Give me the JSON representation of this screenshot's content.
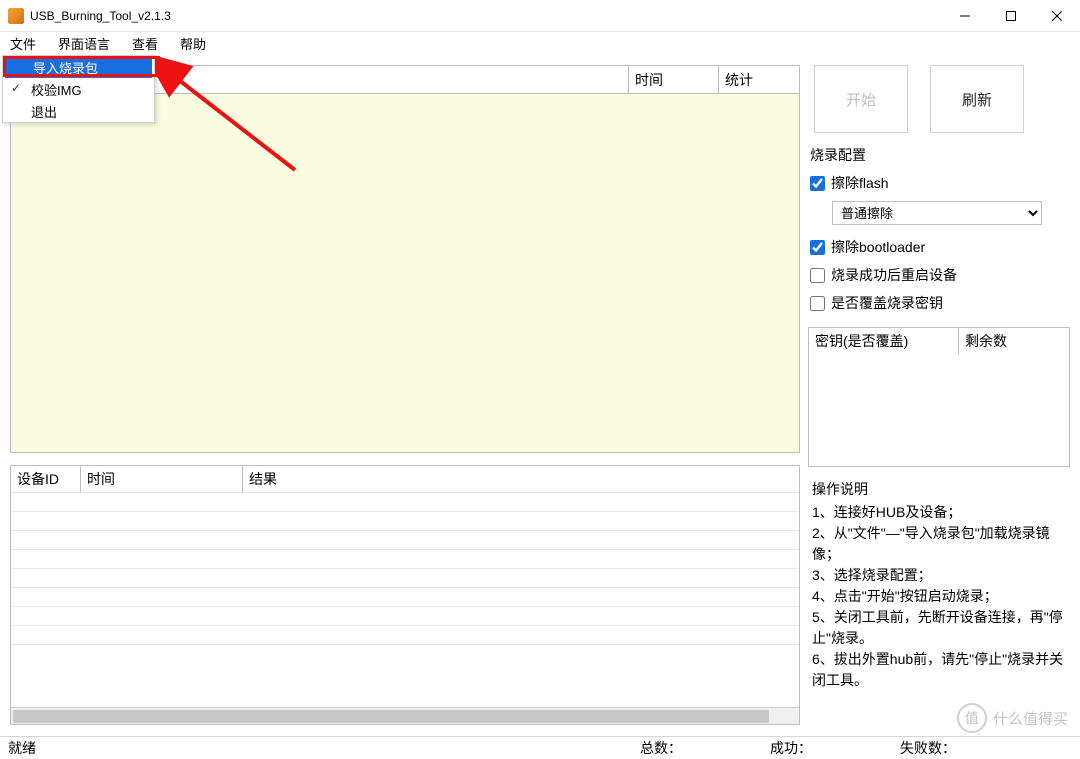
{
  "titlebar": {
    "title": "USB_Burning_Tool_v2.1.3"
  },
  "menubar": {
    "items": [
      "文件",
      "界面语言",
      "查看",
      "帮助"
    ]
  },
  "file_menu": {
    "import": "导入烧录包",
    "verify": "校验IMG",
    "exit": "退出"
  },
  "upper_grid": {
    "headers": {
      "device": "",
      "time": "时间",
      "stat": "统计"
    }
  },
  "lower_grid": {
    "headers": {
      "id": "设备ID",
      "time": "时间",
      "result": "结果"
    }
  },
  "buttons": {
    "start": "开始",
    "refresh": "刷新"
  },
  "burn_cfg": {
    "title": "烧录配置",
    "erase_flash": "擦除flash",
    "erase_mode_options": [
      "普通擦除"
    ],
    "erase_mode_selected": "普通擦除",
    "erase_bootloader": "擦除bootloader",
    "reboot_after": "烧录成功后重启设备",
    "overwrite_key": "是否覆盖烧录密钥"
  },
  "key_table": {
    "col1": "密钥(是否覆盖)",
    "col2": "剩余数"
  },
  "instructions": {
    "title": "操作说明",
    "lines": [
      "1、连接好HUB及设备；",
      "2、从\"文件\"—\"导入烧录包\"加载烧录镜像；",
      "3、选择烧录配置；",
      "4、点击\"开始\"按钮启动烧录；",
      "5、关闭工具前，先断开设备连接，再\"停止\"烧录。",
      "6、拔出外置hub前，请先\"停止\"烧录并关闭工具。"
    ]
  },
  "statusbar": {
    "ready": "就绪",
    "total": "总数：",
    "success": "成功：",
    "fail": "失败数："
  },
  "watermark": {
    "text": "什么值得买",
    "badge": "值"
  }
}
